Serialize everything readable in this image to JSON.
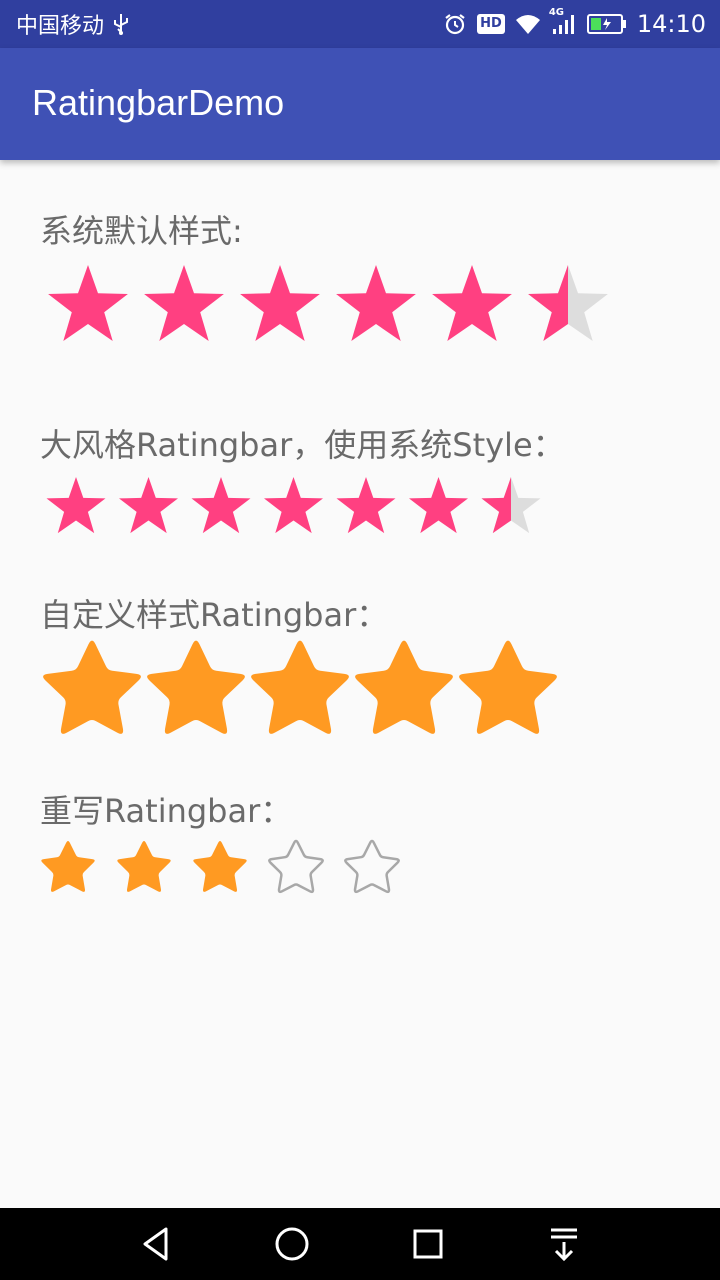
{
  "status_bar": {
    "carrier": "中国移动",
    "hd_badge": "HD",
    "network_badge": "4G",
    "time": "14:10"
  },
  "app_bar": {
    "title": "RatingbarDemo"
  },
  "sections": [
    {
      "label": "系统默认样式:",
      "rating": 5.5,
      "max": 6,
      "fill_color": "#FF4081",
      "empty_color": "#DDDDDD"
    },
    {
      "label": "大风格Ratingbar，使用系统Style：",
      "rating": 6.5,
      "max": 7,
      "fill_color": "#FF4081",
      "empty_color": "#DDDDDD"
    },
    {
      "label": "自定义样式Ratingbar：",
      "rating": 5,
      "max": 5,
      "fill_color": "#FF9A22"
    },
    {
      "label": "重写Ratingbar：",
      "rating": 3,
      "max": 5,
      "fill_color": "#FF9A22",
      "outline_color": "#A8A8A8"
    }
  ],
  "nav_bar": {
    "icons": [
      "back-icon",
      "home-icon",
      "recents-icon",
      "notification-pull-icon"
    ]
  }
}
